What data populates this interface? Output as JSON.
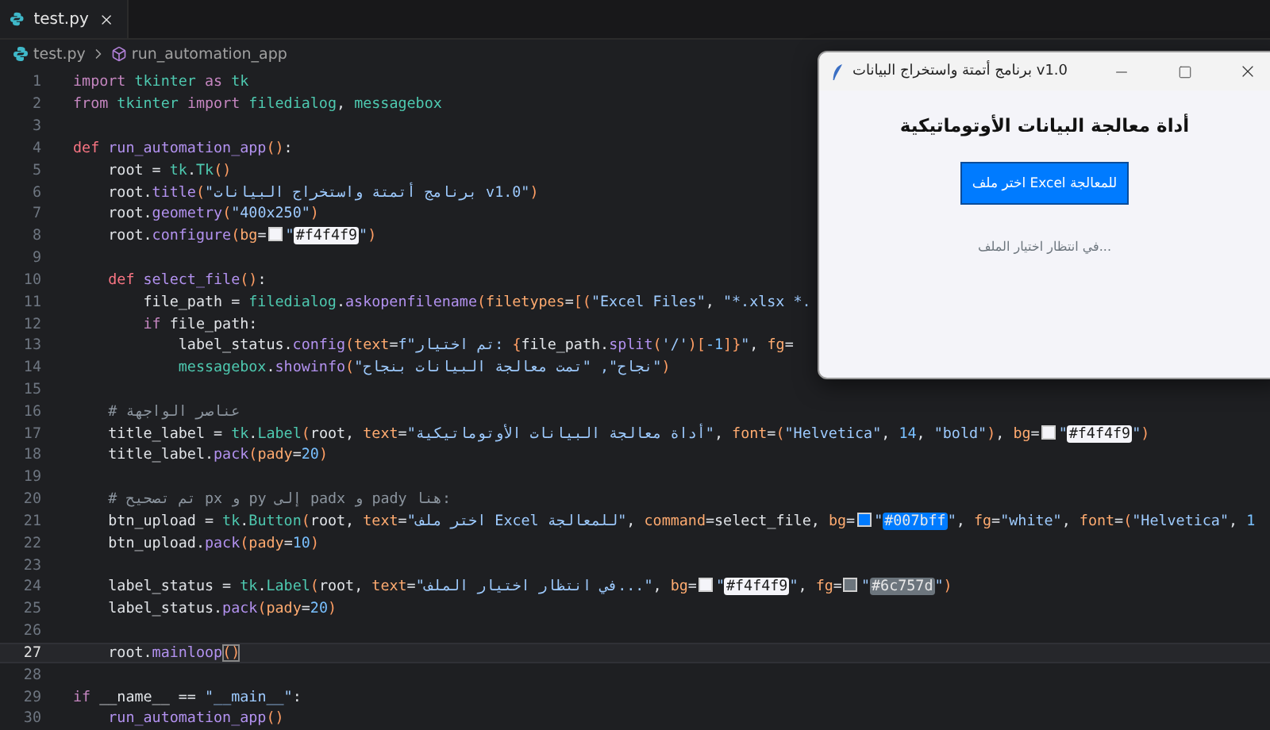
{
  "tab": {
    "label": "test.py",
    "selected": true
  },
  "breadcrumb": {
    "file": "test.py",
    "symbol": "run_automation_app"
  },
  "code_lines": [
    {
      "number": "1",
      "current": false,
      "tokens": [
        {
          "text": "import",
          "kind": "keyword"
        },
        {
          "text": " tkinter",
          "kind": "module"
        },
        {
          "text": " as ",
          "kind": "keyword"
        },
        {
          "text": "tk",
          "kind": "module"
        }
      ]
    },
    {
      "number": "2",
      "current": false,
      "tokens": [
        {
          "text": "from",
          "kind": "keyword"
        },
        {
          "text": " tkinter",
          "kind": "module"
        },
        {
          "text": " import ",
          "kind": "keyword"
        },
        {
          "text": "filedialog",
          "kind": "module"
        },
        {
          "text": ", ",
          "kind": "plain"
        },
        {
          "text": "messagebox",
          "kind": "module"
        }
      ]
    },
    {
      "number": "3",
      "current": false
    },
    {
      "number": "4",
      "current": false,
      "tokens": [
        {
          "text": "def",
          "kind": "def"
        },
        {
          "text": " run_automation_app",
          "kind": "function"
        },
        {
          "text": "()",
          "kind": "bracket"
        },
        {
          "text": ":",
          "kind": "plain"
        }
      ]
    },
    {
      "number": "5",
      "current": false,
      "tokens": [
        {
          "text": "    root = ",
          "kind": "plain"
        },
        {
          "text": "tk",
          "kind": "module"
        },
        {
          "text": ".",
          "kind": "plain"
        },
        {
          "text": "Tk",
          "kind": "module"
        },
        {
          "text": "()",
          "kind": "bracket"
        }
      ]
    },
    {
      "number": "6",
      "current": false,
      "tokens": [
        {
          "text": "    root.",
          "kind": "plain"
        },
        {
          "text": "title",
          "kind": "function"
        },
        {
          "text": "(",
          "kind": "bracket"
        },
        {
          "text": "\"برنامج أتمتة واستخراج البيانات v1.0\"",
          "kind": "string"
        },
        {
          "text": ")",
          "kind": "bracket"
        }
      ]
    },
    {
      "number": "7",
      "current": false,
      "tokens": [
        {
          "text": "    root.",
          "kind": "plain"
        },
        {
          "text": "geometry",
          "kind": "function"
        },
        {
          "text": "(",
          "kind": "bracket"
        },
        {
          "text": "\"400x250\"",
          "kind": "string"
        },
        {
          "text": ")",
          "kind": "bracket"
        }
      ]
    },
    {
      "number": "8",
      "current": false,
      "tokens": [
        {
          "text": "    root.",
          "kind": "plain"
        },
        {
          "text": "configure",
          "kind": "function"
        },
        {
          "text": "(",
          "kind": "bracket"
        },
        {
          "text": "bg",
          "kind": "param"
        },
        {
          "text": "=",
          "kind": "plain"
        },
        {
          "kind": "swatch",
          "color": "#f4f4f9"
        },
        {
          "text": "\"",
          "kind": "string"
        },
        {
          "text": "#f4f4f9",
          "kind": "hex",
          "color": "#f4f4f9"
        },
        {
          "text": "\"",
          "kind": "string"
        },
        {
          "text": ")",
          "kind": "bracket"
        }
      ]
    },
    {
      "number": "9",
      "current": false
    },
    {
      "number": "10",
      "current": false,
      "tokens": [
        {
          "text": "    def",
          "kind": "def"
        },
        {
          "text": " select_file",
          "kind": "function"
        },
        {
          "text": "()",
          "kind": "bracket"
        },
        {
          "text": ":",
          "kind": "plain"
        }
      ]
    },
    {
      "number": "11",
      "current": false,
      "tokens": [
        {
          "text": "        file_path = ",
          "kind": "plain"
        },
        {
          "text": "filedialog",
          "kind": "module"
        },
        {
          "text": ".",
          "kind": "plain"
        },
        {
          "text": "askopenfilename",
          "kind": "function"
        },
        {
          "text": "(",
          "kind": "bracket"
        },
        {
          "text": "filetypes",
          "kind": "param"
        },
        {
          "text": "=",
          "kind": "plain"
        },
        {
          "text": "[(",
          "kind": "bracket"
        },
        {
          "text": "\"Excel Files\"",
          "kind": "string"
        },
        {
          "text": ", ",
          "kind": "plain"
        },
        {
          "text": "\"*.xlsx *.",
          "kind": "string"
        }
      ]
    },
    {
      "number": "12",
      "current": false,
      "tokens": [
        {
          "text": "        if",
          "kind": "keyword"
        },
        {
          "text": " file_path:",
          "kind": "plain"
        }
      ]
    },
    {
      "number": "13",
      "current": false,
      "tokens": [
        {
          "text": "            label_status.",
          "kind": "plain"
        },
        {
          "text": "config",
          "kind": "function"
        },
        {
          "text": "(",
          "kind": "bracket"
        },
        {
          "text": "text",
          "kind": "param"
        },
        {
          "text": "=",
          "kind": "plain"
        },
        {
          "text": "f\"تم اختيار: ",
          "kind": "string"
        },
        {
          "text": "{",
          "kind": "bracket"
        },
        {
          "text": "file_path.",
          "kind": "plain"
        },
        {
          "text": "split",
          "kind": "function"
        },
        {
          "text": "(",
          "kind": "bracket"
        },
        {
          "text": "'/'",
          "kind": "string"
        },
        {
          "text": ")[",
          "kind": "bracket"
        },
        {
          "text": "-1",
          "kind": "number"
        },
        {
          "text": "]}",
          "kind": "bracket"
        },
        {
          "text": "\"",
          "kind": "string"
        },
        {
          "text": ", ",
          "kind": "plain"
        },
        {
          "text": "fg",
          "kind": "param"
        },
        {
          "text": "=",
          "kind": "plain"
        }
      ]
    },
    {
      "number": "14",
      "current": false,
      "tokens": [
        {
          "text": "            messagebox",
          "kind": "module"
        },
        {
          "text": ".",
          "kind": "plain"
        },
        {
          "text": "showinfo",
          "kind": "function"
        },
        {
          "text": "(",
          "kind": "bracket"
        },
        {
          "text": "\"نجاح\", \"تمت معالجة البيانات بنجاح\"",
          "kind": "string"
        },
        {
          "text": ")",
          "kind": "bracket"
        }
      ]
    },
    {
      "number": "15",
      "current": false
    },
    {
      "number": "16",
      "current": false,
      "tokens": [
        {
          "text": "    # عناصر الواجهة",
          "kind": "comment"
        }
      ]
    },
    {
      "number": "17",
      "current": false,
      "tokens": [
        {
          "text": "    title_label = ",
          "kind": "plain"
        },
        {
          "text": "tk",
          "kind": "module"
        },
        {
          "text": ".",
          "kind": "plain"
        },
        {
          "text": "Label",
          "kind": "module"
        },
        {
          "text": "(",
          "kind": "bracket"
        },
        {
          "text": "root, ",
          "kind": "plain"
        },
        {
          "text": "text",
          "kind": "param"
        },
        {
          "text": "=",
          "kind": "plain"
        },
        {
          "text": "\"أداة معالجة البيانات الأوتوماتيكية\"",
          "kind": "string"
        },
        {
          "text": ", ",
          "kind": "plain"
        },
        {
          "text": "font",
          "kind": "param"
        },
        {
          "text": "=",
          "kind": "plain"
        },
        {
          "text": "(",
          "kind": "bracket"
        },
        {
          "text": "\"Helvetica\"",
          "kind": "string"
        },
        {
          "text": ", ",
          "kind": "plain"
        },
        {
          "text": "14",
          "kind": "number"
        },
        {
          "text": ", ",
          "kind": "plain"
        },
        {
          "text": "\"bold\"",
          "kind": "string"
        },
        {
          "text": ")",
          "kind": "bracket"
        },
        {
          "text": ", ",
          "kind": "plain"
        },
        {
          "text": "bg",
          "kind": "param"
        },
        {
          "text": "=",
          "kind": "plain"
        },
        {
          "kind": "swatch",
          "color": "#f4f4f9"
        },
        {
          "text": "\"",
          "kind": "string"
        },
        {
          "text": "#f4f4f9",
          "kind": "hex",
          "color": "#f4f4f9"
        },
        {
          "text": "\"",
          "kind": "string"
        },
        {
          "text": ")",
          "kind": "bracket"
        }
      ]
    },
    {
      "number": "18",
      "current": false,
      "tokens": [
        {
          "text": "    title_label.",
          "kind": "plain"
        },
        {
          "text": "pack",
          "kind": "function"
        },
        {
          "text": "(",
          "kind": "bracket"
        },
        {
          "text": "pady",
          "kind": "param"
        },
        {
          "text": "=",
          "kind": "plain"
        },
        {
          "text": "20",
          "kind": "number"
        },
        {
          "text": ")",
          "kind": "bracket"
        }
      ]
    },
    {
      "number": "19",
      "current": false
    },
    {
      "number": "20",
      "current": false,
      "tokens": [
        {
          "text": "    # تم تصحيح px و py إلى padx و pady هنا:",
          "kind": "comment"
        }
      ]
    },
    {
      "number": "21",
      "current": false,
      "tokens": [
        {
          "text": "    btn_upload = ",
          "kind": "plain"
        },
        {
          "text": "tk",
          "kind": "module"
        },
        {
          "text": ".",
          "kind": "plain"
        },
        {
          "text": "Button",
          "kind": "module"
        },
        {
          "text": "(",
          "kind": "bracket"
        },
        {
          "text": "root, ",
          "kind": "plain"
        },
        {
          "text": "text",
          "kind": "param"
        },
        {
          "text": "=",
          "kind": "plain"
        },
        {
          "text": "\"اختر ملف Excel للمعالجة\"",
          "kind": "string"
        },
        {
          "text": ", ",
          "kind": "plain"
        },
        {
          "text": "command",
          "kind": "param"
        },
        {
          "text": "=select_file, ",
          "kind": "plain"
        },
        {
          "text": "bg",
          "kind": "param"
        },
        {
          "text": "=",
          "kind": "plain"
        },
        {
          "kind": "swatch",
          "color": "#007bff"
        },
        {
          "text": "\"",
          "kind": "string"
        },
        {
          "text": "#007bff",
          "kind": "hex",
          "color": "#007bff"
        },
        {
          "text": "\"",
          "kind": "string"
        },
        {
          "text": ", ",
          "kind": "plain"
        },
        {
          "text": "fg",
          "kind": "param"
        },
        {
          "text": "=",
          "kind": "plain"
        },
        {
          "text": "\"white\"",
          "kind": "string"
        },
        {
          "text": ", ",
          "kind": "plain"
        },
        {
          "text": "font",
          "kind": "param"
        },
        {
          "text": "=",
          "kind": "plain"
        },
        {
          "text": "(",
          "kind": "bracket"
        },
        {
          "text": "\"Helvetica\"",
          "kind": "string"
        },
        {
          "text": ", ",
          "kind": "plain"
        },
        {
          "text": "1",
          "kind": "number"
        }
      ]
    },
    {
      "number": "22",
      "current": false,
      "tokens": [
        {
          "text": "    btn_upload.",
          "kind": "plain"
        },
        {
          "text": "pack",
          "kind": "function"
        },
        {
          "text": "(",
          "kind": "bracket"
        },
        {
          "text": "pady",
          "kind": "param"
        },
        {
          "text": "=",
          "kind": "plain"
        },
        {
          "text": "10",
          "kind": "number"
        },
        {
          "text": ")",
          "kind": "bracket"
        }
      ]
    },
    {
      "number": "23",
      "current": false
    },
    {
      "number": "24",
      "current": false,
      "tokens": [
        {
          "text": "    label_status = ",
          "kind": "plain"
        },
        {
          "text": "tk",
          "kind": "module"
        },
        {
          "text": ".",
          "kind": "plain"
        },
        {
          "text": "Label",
          "kind": "module"
        },
        {
          "text": "(",
          "kind": "bracket"
        },
        {
          "text": "root, ",
          "kind": "plain"
        },
        {
          "text": "text",
          "kind": "param"
        },
        {
          "text": "=",
          "kind": "plain"
        },
        {
          "text": "\"في انتظار اختيار الملف...\"",
          "kind": "string"
        },
        {
          "text": ", ",
          "kind": "plain"
        },
        {
          "text": "bg",
          "kind": "param"
        },
        {
          "text": "=",
          "kind": "plain"
        },
        {
          "kind": "swatch",
          "color": "#f4f4f9"
        },
        {
          "text": "\"",
          "kind": "string"
        },
        {
          "text": "#f4f4f9",
          "kind": "hex",
          "color": "#f4f4f9"
        },
        {
          "text": "\"",
          "kind": "string"
        },
        {
          "text": ", ",
          "kind": "plain"
        },
        {
          "text": "fg",
          "kind": "param"
        },
        {
          "text": "=",
          "kind": "plain"
        },
        {
          "kind": "swatch",
          "color": "#6c757d"
        },
        {
          "text": "\"",
          "kind": "string"
        },
        {
          "text": "#6c757d",
          "kind": "hex",
          "color": "#6c757d"
        },
        {
          "text": "\"",
          "kind": "string"
        },
        {
          "text": ")",
          "kind": "bracket"
        }
      ]
    },
    {
      "number": "25",
      "current": false,
      "tokens": [
        {
          "text": "    label_status.",
          "kind": "plain"
        },
        {
          "text": "pack",
          "kind": "function"
        },
        {
          "text": "(",
          "kind": "bracket"
        },
        {
          "text": "pady",
          "kind": "param"
        },
        {
          "text": "=",
          "kind": "plain"
        },
        {
          "text": "20",
          "kind": "number"
        },
        {
          "text": ")",
          "kind": "bracket"
        }
      ]
    },
    {
      "number": "26",
      "current": false
    },
    {
      "number": "27",
      "current": true,
      "tokens": [
        {
          "text": "    root.",
          "kind": "plain"
        },
        {
          "text": "mainloop",
          "kind": "function"
        },
        {
          "text": "()",
          "kind": "bracket"
        }
      ]
    },
    {
      "number": "28",
      "current": false
    },
    {
      "number": "29",
      "current": false,
      "tokens": [
        {
          "text": "if",
          "kind": "keyword"
        },
        {
          "text": " __name__ == ",
          "kind": "plain"
        },
        {
          "text": "\"__main__\"",
          "kind": "string"
        },
        {
          "text": ":",
          "kind": "plain"
        }
      ]
    },
    {
      "number": "30",
      "current": false,
      "tokens": [
        {
          "text": "    run_automation_app",
          "kind": "function"
        },
        {
          "text": "()",
          "kind": "bracket"
        }
      ]
    }
  ],
  "app_window": {
    "title": "برنامج أتمتة واستخراج البيانات v1.0",
    "heading": "أداة معالجة البيانات الأوتوماتيكية",
    "button": "اختر ملف Excel للمعالجة",
    "status": "في انتظار اختيار الملف..."
  }
}
